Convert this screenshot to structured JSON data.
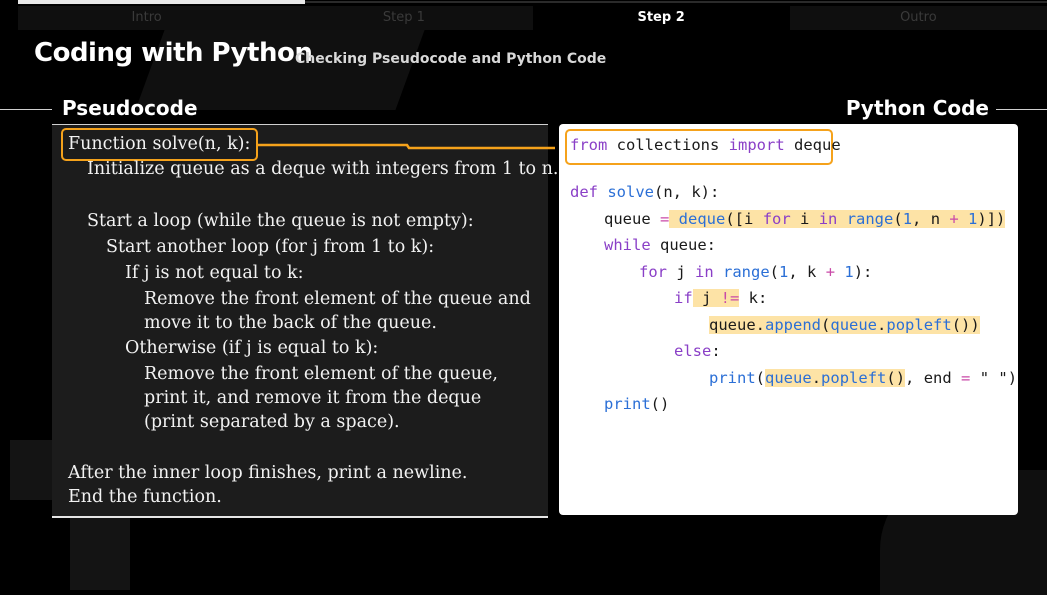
{
  "steps": [
    {
      "label": "Intro",
      "active": false
    },
    {
      "label": "Step 1",
      "active": false
    },
    {
      "label": "Step 2",
      "active": true
    },
    {
      "label": "Outro",
      "active": false
    }
  ],
  "header": {
    "title": "Coding with Python",
    "subtitle": "Checking Pseudocode and Python Code"
  },
  "sections": {
    "pseudocode_label": "Pseudocode",
    "python_label": "Python Code"
  },
  "pseudocode": {
    "l1": "Function solve(n, k):",
    "l2": "Initialize queue as a deque with integers from 1 to n.",
    "l3": "Start a loop (while the queue is not empty):",
    "l4": "Start another loop (for j from 1 to k):",
    "l5": "If j is not equal to k:",
    "l6": "Remove the front element of the queue and",
    "l7": "move it to the back of the queue.",
    "l8": "Otherwise (if j is equal to k):",
    "l9": "Remove the front element of the queue,",
    "l10": "print it, and remove it from the deque",
    "l11": "(print separated by a space).",
    "l12": "After the inner loop finishes, print a newline.",
    "l13": "End the function."
  },
  "code": {
    "import": {
      "kw1": "from",
      "mod": " collections ",
      "kw2": "import",
      "name": " deque"
    },
    "def": {
      "kw": "def",
      "fn": " solve",
      "args": "(n, k):"
    },
    "queue": {
      "a": "queue ",
      "eq": "=",
      "fn": " deque",
      "b": "([",
      "c": "i ",
      "kw1": "for",
      "d": " i ",
      "kw2": "in",
      "fn2": " range",
      "e": "(",
      "n1": "1",
      "f": ", n ",
      "plus": "+",
      "n2": " 1",
      "g": ")])"
    },
    "while": {
      "kw": "while",
      "rest": " queue:"
    },
    "for": {
      "kw": "for",
      "a": " j ",
      "kw2": "in",
      "fn": " range",
      "b": "(",
      "n1": "1",
      "c": ", k ",
      "plus": "+",
      "n2": " 1",
      "d": "):"
    },
    "if": {
      "kw": "if",
      "a": " j ",
      "op": "!=",
      "b": " k:"
    },
    "append": {
      "a": "queue",
      "dot": ".",
      "fn": "append",
      "b": "(",
      "c": "queue",
      "dot2": ".",
      "fn2": "popleft",
      "d": "())"
    },
    "else": {
      "kw": "else",
      "rest": ":"
    },
    "print1": {
      "fn": "print",
      "a": "(",
      "b": "queue",
      "dot": ".",
      "fn2": "popleft",
      "c": "()",
      "d": ", end ",
      "eq": "=",
      "e": " \" \")"
    },
    "print2": {
      "fn": "print",
      "rest": "()"
    }
  },
  "colors": {
    "accent": "#f5a21b",
    "highlight": "#fde3a6",
    "keyword": "#8a3fc7",
    "function": "#2b6fd6"
  }
}
